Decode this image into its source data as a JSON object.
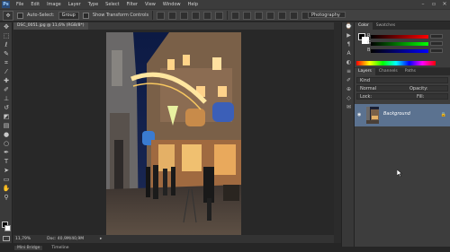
{
  "menubar": {
    "logo": "Ps",
    "items": [
      "File",
      "Edit",
      "Image",
      "Layer",
      "Type",
      "Select",
      "Filter",
      "View",
      "Window",
      "Help"
    ],
    "window_buttons": [
      "–",
      "▫",
      "✕"
    ]
  },
  "options": {
    "auto_select_label": "Auto-Select:",
    "auto_select_value": "Group",
    "transform_label": "Show Transform Controls"
  },
  "workspace": "Photography",
  "document": {
    "tab_title": "DSC_0051.jpg @ 11,6% (RGB/8*)",
    "zoom": "11,79%",
    "doc_size": "Doc: 40,9M/40,9M"
  },
  "bottom_tabs": [
    "Mini Bridge",
    "Timeline"
  ],
  "panels": {
    "color_tabs": [
      "Color",
      "Swatches"
    ],
    "color_channels": [
      "R",
      "G",
      "B"
    ],
    "layers_tabs": [
      "Layers",
      "Channels",
      "Paths"
    ],
    "layers_kind": "Kind",
    "layers_blend": "Normal",
    "layers_opacity_label": "Opacity:",
    "layers_lock_label": "Lock:",
    "layers_fill_label": "Fill:",
    "layer_name": "Background"
  },
  "icons": {
    "tools": [
      "move-icon",
      "marquee-icon",
      "lasso-icon",
      "quick-select-icon",
      "crop-icon",
      "eyedropper-icon",
      "healing-icon",
      "brush-icon",
      "stamp-icon",
      "history-brush-icon",
      "eraser-icon",
      "gradient-icon",
      "blur-icon",
      "dodge-icon",
      "pen-icon",
      "type-icon",
      "path-select-icon",
      "shape-icon",
      "hand-icon",
      "zoom-icon"
    ],
    "right_column": [
      "history-icon",
      "actions-icon",
      "paragraph-icon",
      "character-icon",
      "adjustments-icon",
      "properties-icon",
      "brush-preset-icon",
      "clone-source-icon",
      "3d-icon"
    ]
  }
}
